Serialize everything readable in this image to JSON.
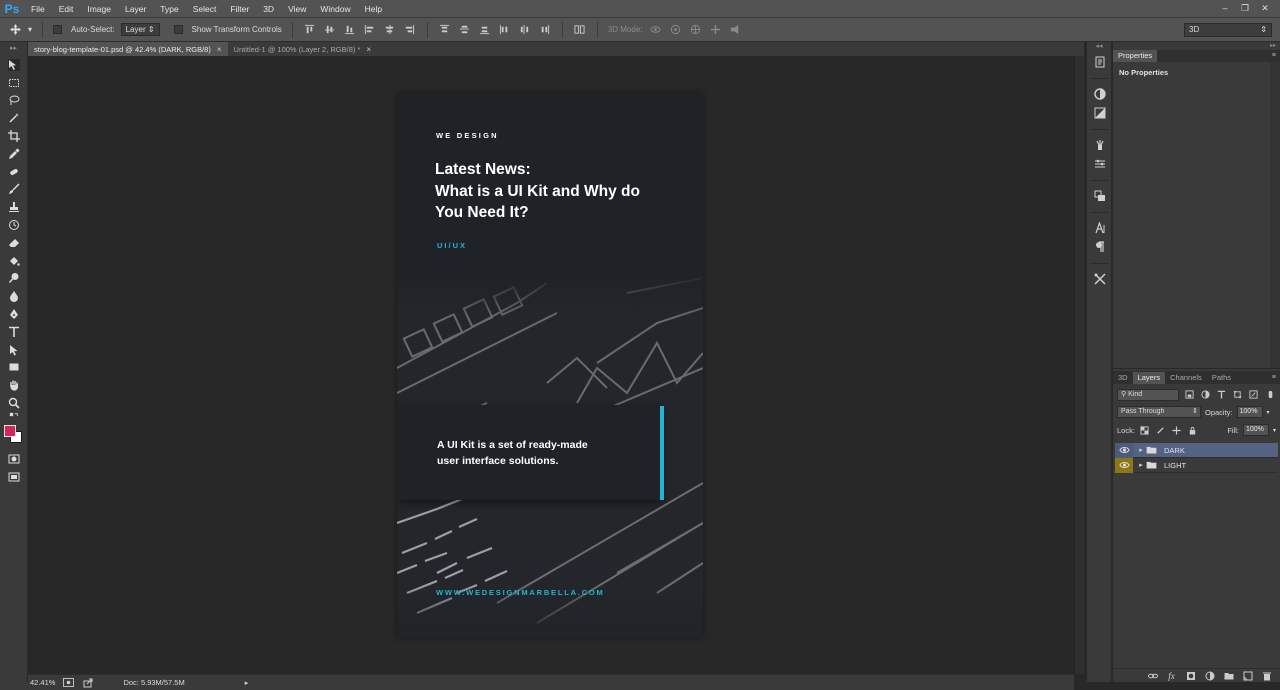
{
  "app": {
    "logo": "Ps"
  },
  "menu": [
    "File",
    "Edit",
    "Image",
    "Layer",
    "Type",
    "Select",
    "Filter",
    "3D",
    "View",
    "Window",
    "Help"
  ],
  "options": {
    "auto_select_label": "Auto-Select:",
    "auto_select_target": "Layer",
    "show_transform_label": "Show Transform Controls",
    "mode_3d_label": "3D Mode:",
    "workspace": "3D"
  },
  "tabs": [
    {
      "label": "story-blog-template-01.psd @ 42.4% (DARK, RGB/8)",
      "active": true
    },
    {
      "label": "Untitled-1 @ 100% (Layer 2, RGB/8) *",
      "active": false
    }
  ],
  "colors": {
    "foreground": "#d3275a",
    "background": "#ffffff",
    "accent": "#23b5d3"
  },
  "artboard": {
    "brand": "WE DESIGN",
    "headline_line1": "Latest News:",
    "headline_line2": "What is a UI Kit and Why do",
    "headline_line3": "You Need It?",
    "category": "UI/UX",
    "quote_line1": "A UI Kit is a set of ready-made",
    "quote_line2": "user interface solutions.",
    "website": "WWW.WEDESIGNMARBELLA.COM"
  },
  "properties": {
    "tab": "Properties",
    "body": "No Properties"
  },
  "layers_panel": {
    "tabs": [
      "3D",
      "Layers",
      "Channels",
      "Paths"
    ],
    "active_tab": "Layers",
    "filter_kind": "Kind",
    "blend_mode": "Pass Through",
    "opacity_label": "Opacity:",
    "opacity": "100%",
    "lock_label": "Lock:",
    "fill_label": "Fill:",
    "fill": "100%",
    "layers": [
      {
        "name": "DARK",
        "selected": true
      },
      {
        "name": "LIGHT",
        "selected": false
      }
    ]
  },
  "status": {
    "zoom": "42.41%",
    "doc": "Doc: 5.93M/57.5M"
  }
}
